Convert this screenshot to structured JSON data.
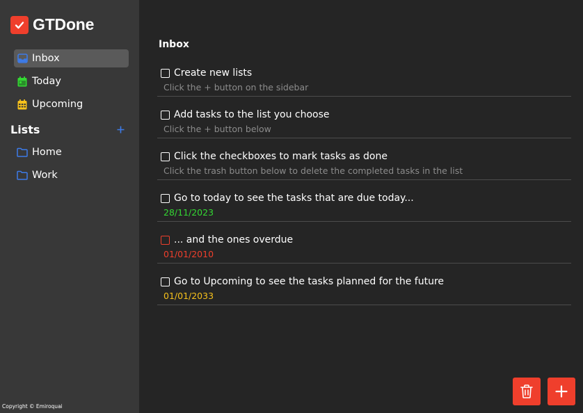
{
  "app": {
    "title": "GTDone",
    "copyright": "Copyright © Emiroquai"
  },
  "sidebar": {
    "items": [
      {
        "label": "Inbox",
        "icon": "inbox-icon",
        "color": "#3d7be8",
        "active": true
      },
      {
        "label": "Today",
        "icon": "calendar-today-icon",
        "color": "#34d833",
        "active": false
      },
      {
        "label": "Upcoming",
        "icon": "calendar-grid-icon",
        "color": "#f6c11b",
        "active": false
      }
    ],
    "lists_title": "Lists",
    "lists": [
      {
        "label": "Home",
        "icon": "folder-icon"
      },
      {
        "label": "Work",
        "icon": "folder-icon"
      }
    ]
  },
  "main": {
    "title": "Inbox",
    "tasks": [
      {
        "title": "Create new lists",
        "subtitle": "Click the + button on the sidebar"
      },
      {
        "title": "Add tasks to the list you choose",
        "subtitle": "Click the + button below"
      },
      {
        "title": "Click the checkboxes to mark tasks as done",
        "subtitle": "Click the trash button below to delete the completed tasks in the list"
      },
      {
        "title": "Go to today to see the tasks that are due today...",
        "date": "28/11/2023",
        "date_status": "today"
      },
      {
        "title": "... and the ones overdue",
        "date": "01/01/2010",
        "date_status": "overdue"
      },
      {
        "title": "Go to Upcoming to see the tasks planned for the future",
        "date": "01/01/2033",
        "date_status": "upcoming"
      }
    ]
  },
  "actions": {
    "delete_icon": "trash-icon",
    "add_icon": "plus-icon"
  },
  "colors": {
    "accent": "#ef3f2c",
    "sidebar_bg": "#383838",
    "main_bg": "#252525",
    "today": "#34d833",
    "overdue": "#ef3f2c",
    "upcoming": "#f6c11b",
    "list_folder": "#3d7be8"
  }
}
